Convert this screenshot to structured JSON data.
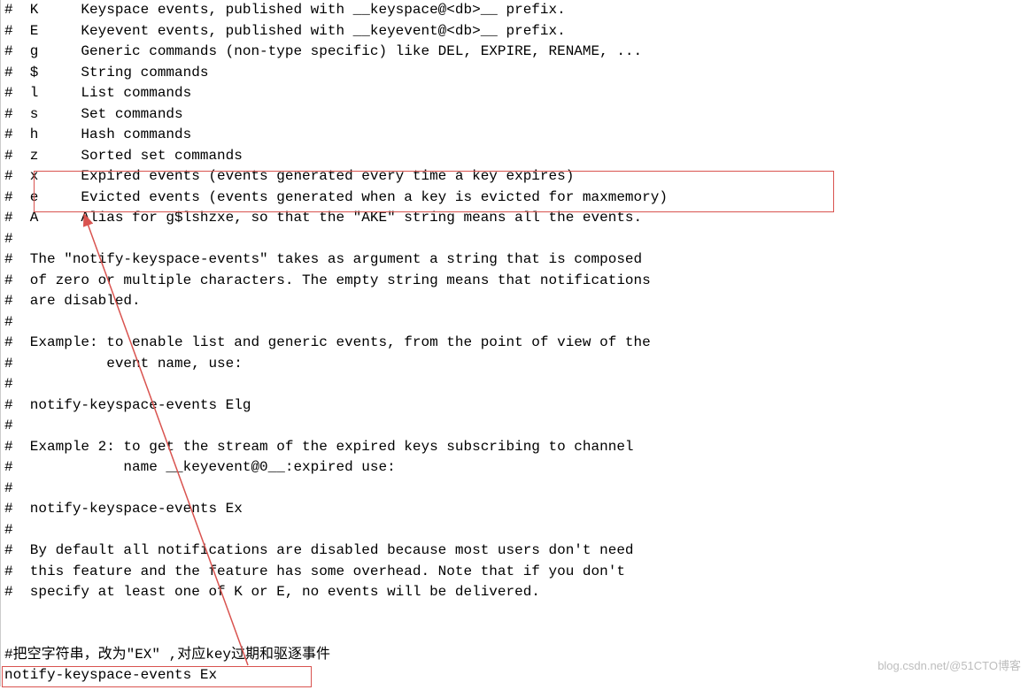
{
  "lines": [
    "#  K     Keyspace events, published with __keyspace@<db>__ prefix.",
    "#  E     Keyevent events, published with __keyevent@<db>__ prefix.",
    "#  g     Generic commands (non-type specific) like DEL, EXPIRE, RENAME, ...",
    "#  $     String commands",
    "#  l     List commands",
    "#  s     Set commands",
    "#  h     Hash commands",
    "#  z     Sorted set commands",
    "#  x     Expired events (events generated every time a key expires)",
    "#  e     Evicted events (events generated when a key is evicted for maxmemory)",
    "#  A     Alias for g$lshzxe, so that the \"AKE\" string means all the events.",
    "#",
    "#  The \"notify-keyspace-events\" takes as argument a string that is composed",
    "#  of zero or multiple characters. The empty string means that notifications",
    "#  are disabled.",
    "#",
    "#  Example: to enable list and generic events, from the point of view of the",
    "#           event name, use:",
    "#",
    "#  notify-keyspace-events Elg",
    "#",
    "#  Example 2: to get the stream of the expired keys subscribing to channel",
    "#             name __keyevent@0__:expired use:",
    "#",
    "#  notify-keyspace-events Ex",
    "#",
    "#  By default all notifications are disabled because most users don't need",
    "#  this feature and the feature has some overhead. Note that if you don't",
    "#  specify at least one of K or E, no events will be delivered.",
    "",
    "",
    "#把空字符串，改为\"EX\" ,对应key过期和驱逐事件",
    "notify-keyspace-events Ex"
  ],
  "watermark": "blog.csdn.net/@51CTO博客"
}
